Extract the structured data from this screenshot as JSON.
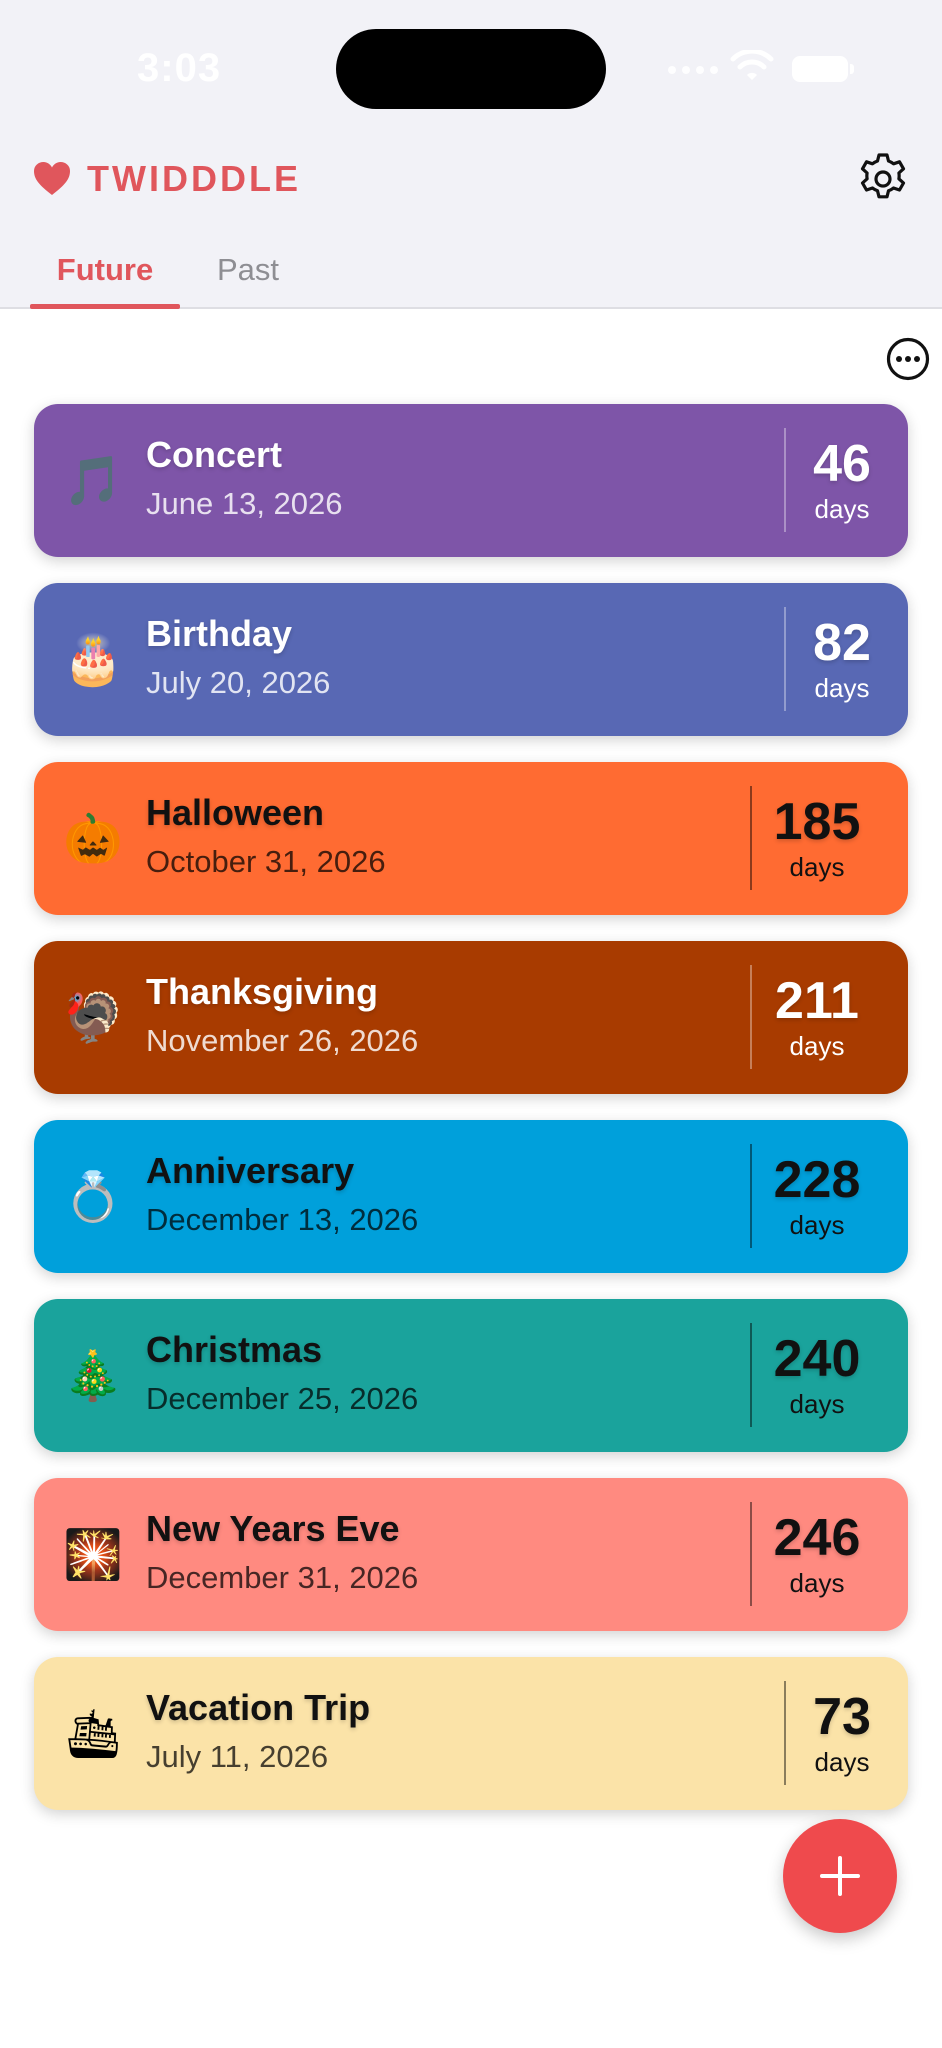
{
  "status_bar": {
    "time": "3:03"
  },
  "header": {
    "brand": "TWIDDDLE",
    "brand_color": "#e0565c",
    "heart_icon": "heart-icon",
    "settings_icon": "gear-icon"
  },
  "tabs": [
    {
      "label": "Future",
      "selected": true
    },
    {
      "label": "Past",
      "selected": false
    }
  ],
  "toolbar": {
    "more_icon": "ellipsis-circle-icon"
  },
  "events": [
    {
      "emoji": "🎵",
      "title": "Concert",
      "date": "June 13, 2026",
      "count": "46",
      "unit": "days",
      "color": "#7e55a8",
      "text": "light"
    },
    {
      "emoji": "🎂",
      "title": "Birthday",
      "date": "July 20, 2026",
      "count": "82",
      "unit": "days",
      "color": "#5868b4",
      "text": "light"
    },
    {
      "emoji": "🎃",
      "title": "Halloween",
      "date": "October 31, 2026",
      "count": "185",
      "unit": "days",
      "color": "#ff6b32",
      "text": "dark"
    },
    {
      "emoji": "🦃",
      "title": "Thanksgiving",
      "date": "November 26, 2026",
      "count": "211",
      "unit": "days",
      "color": "#a83b00",
      "text": "light"
    },
    {
      "emoji": "💍",
      "title": "Anniversary",
      "date": "December 13, 2026",
      "count": "228",
      "unit": "days",
      "color": "#00a0db",
      "text": "dark"
    },
    {
      "emoji": "🎄",
      "title": "Christmas",
      "date": "December 25, 2026",
      "count": "240",
      "unit": "days",
      "color": "#1aa39c",
      "text": "dark"
    },
    {
      "emoji": "🎇",
      "title": "New Years Eve",
      "date": "December 31, 2026",
      "count": "246",
      "unit": "days",
      "color": "#ff8a80",
      "text": "dark"
    },
    {
      "emoji": "🛳",
      "title": "Vacation Trip",
      "date": "July 11, 2026",
      "count": "73",
      "unit": "days",
      "color": "#fbe3a8",
      "text": "dark"
    }
  ],
  "fab": {
    "icon": "plus-icon",
    "color": "#ef4a4d"
  }
}
